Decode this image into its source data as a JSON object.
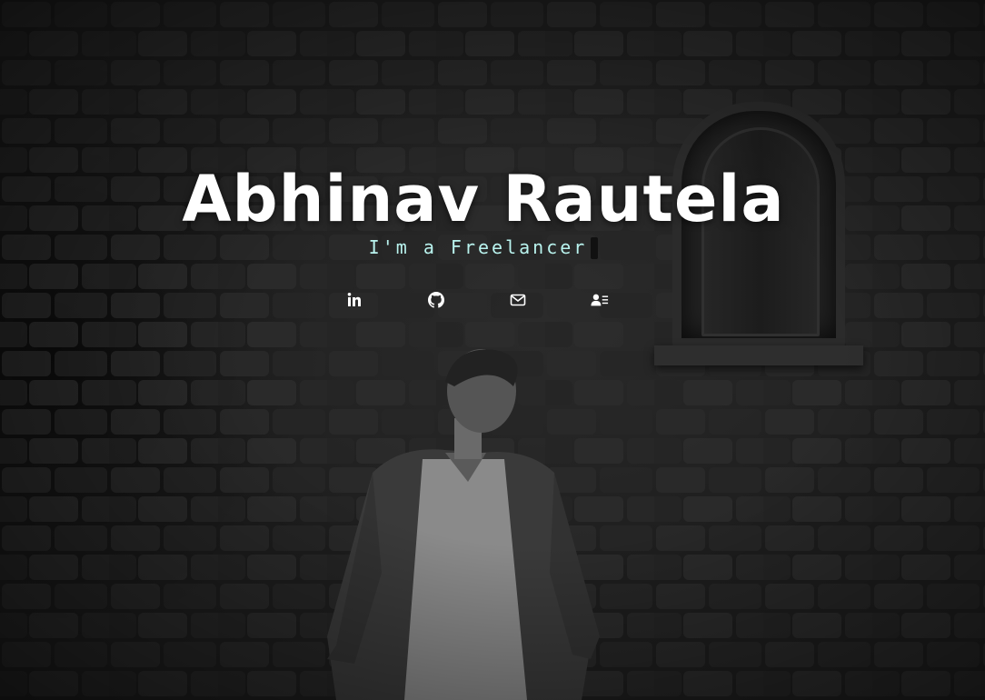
{
  "hero": {
    "name": "Abhinav Rautela",
    "subtitle_prefix": "I'm a ",
    "subtitle_role": "Freelancer"
  },
  "socials": [
    {
      "icon": "linkedin-icon",
      "label": "LinkedIn"
    },
    {
      "icon": "github-icon",
      "label": "GitHub"
    },
    {
      "icon": "mail-icon",
      "label": "Email"
    },
    {
      "icon": "resume-icon",
      "label": "Resume"
    }
  ],
  "colors": {
    "name": "#ffffff",
    "subtitle": "#b9f3ee",
    "background": "#1d1d1d"
  }
}
